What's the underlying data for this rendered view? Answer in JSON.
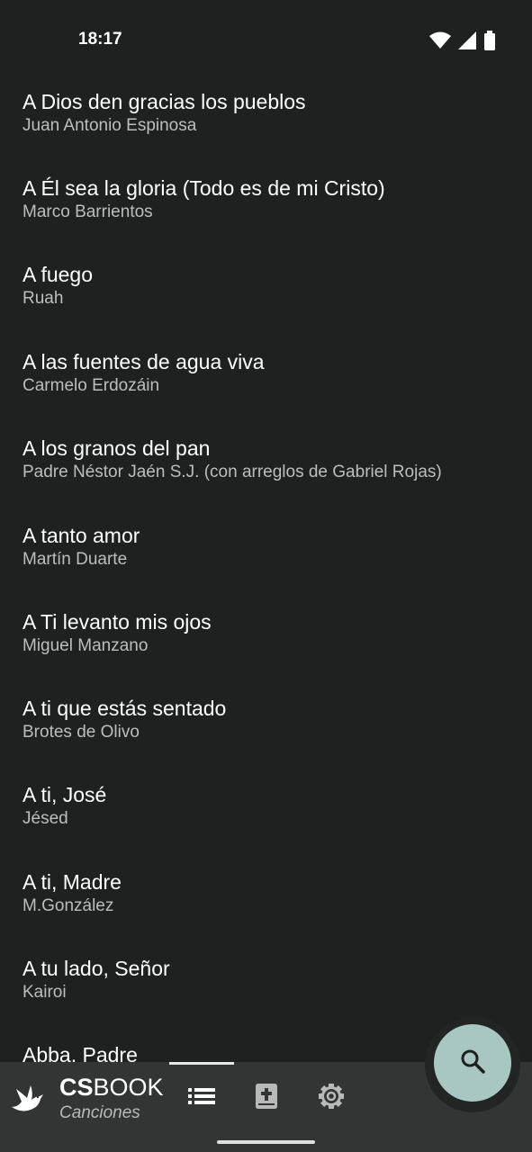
{
  "status_bar": {
    "time": "18:17",
    "icons": [
      "wifi-icon",
      "signal-icon",
      "battery-icon"
    ]
  },
  "songs": [
    {
      "title": "A Dios den gracias los pueblos",
      "author": "Juan Antonio Espinosa"
    },
    {
      "title": "A Él sea la gloria (Todo es de mi Cristo)",
      "author": "Marco Barrientos"
    },
    {
      "title": "A fuego",
      "author": "Ruah"
    },
    {
      "title": "A las fuentes de agua viva",
      "author": "Carmelo Erdozáin"
    },
    {
      "title": "A los granos del pan",
      "author": "Padre Néstor Jaén S.J. (con arreglos de Gabriel Rojas)"
    },
    {
      "title": "A tanto amor",
      "author": "Martín Duarte"
    },
    {
      "title": "A Ti levanto mis ojos",
      "author": "Miguel Manzano"
    },
    {
      "title": "A ti que estás sentado",
      "author": "Brotes de Olivo"
    },
    {
      "title": "A ti, José",
      "author": "Jésed"
    },
    {
      "title": "A ti, Madre",
      "author": "M.González"
    },
    {
      "title": "A tu lado, Señor",
      "author": "Kairoi"
    },
    {
      "title": "Abba, Padre",
      "author": ""
    }
  ],
  "brand": {
    "title_bold": "CS",
    "title_rest": "BOOK",
    "subtitle": "Canciones",
    "logo_icon": "dove-icon"
  },
  "nav": {
    "items": [
      {
        "icon": "list-icon",
        "selected": true
      },
      {
        "icon": "bible-icon",
        "selected": false
      },
      {
        "icon": "gear-icon",
        "selected": false
      }
    ]
  },
  "fab": {
    "icon": "search-icon"
  },
  "colors": {
    "background": "#1f2020",
    "nav_background": "#333434",
    "fab": "#a9c7c2",
    "text_primary": "#ffffff",
    "text_secondary": "#bdbdbd"
  }
}
